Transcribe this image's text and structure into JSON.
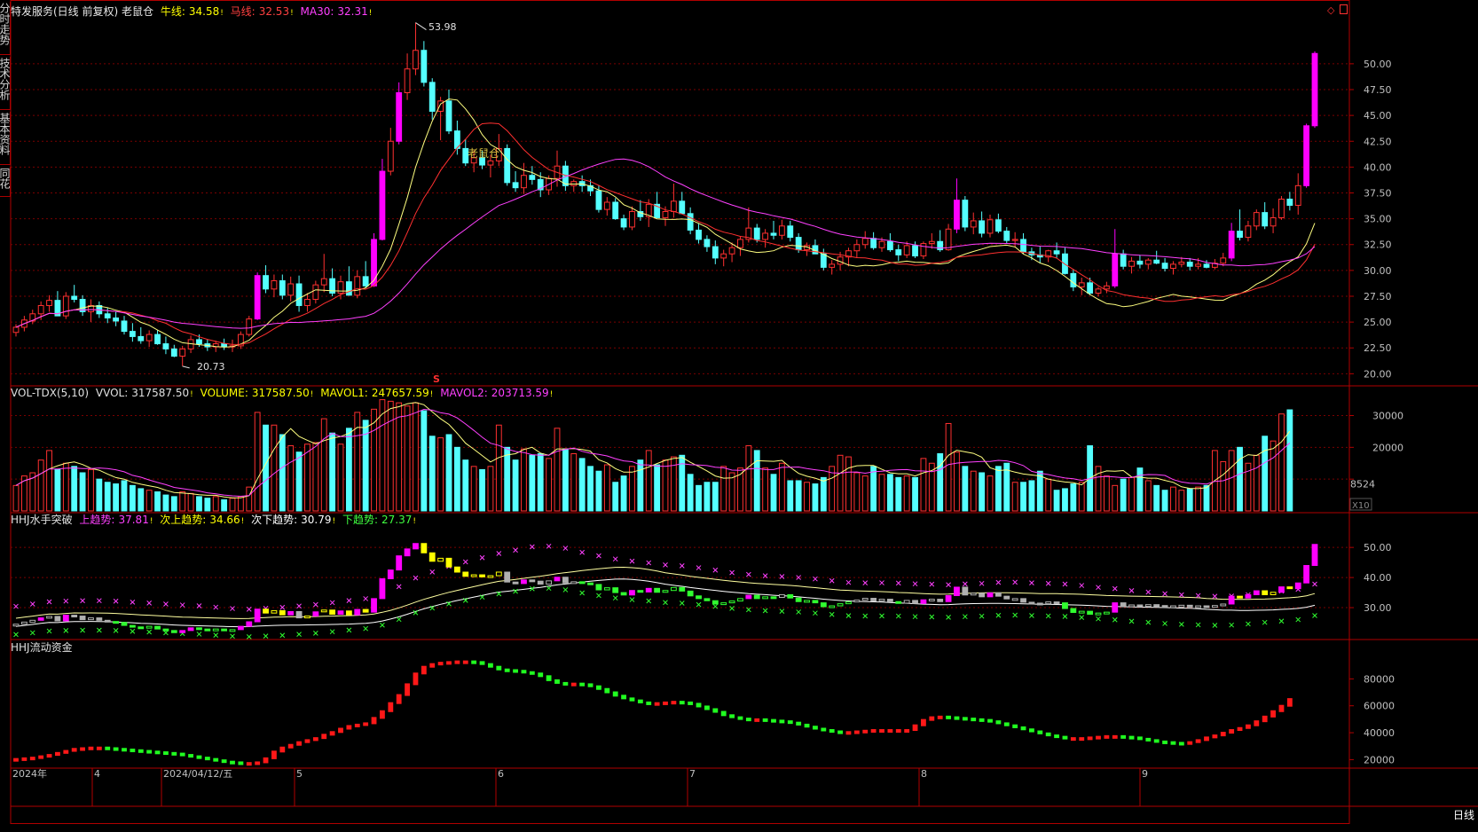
{
  "side_tabs": [
    "分时走势",
    "技术分析",
    "基本资料",
    "同花"
  ],
  "main_header": {
    "title": "特发服务(日线 前复权) 老鼠仓",
    "items": [
      {
        "label": "牛线:",
        "value": "34.58",
        "color": "#ffff00"
      },
      {
        "label": "马线:",
        "value": "32.53",
        "color": "#ff4040"
      },
      {
        "label": "MA30:",
        "value": "32.31",
        "color": "#ff40ff"
      }
    ]
  },
  "high_label": "53.98",
  "low_label": "20.73",
  "watermark_text": "老鼠仓",
  "s_marker": "S",
  "price_axis": [
    "50.00",
    "47.50",
    "45.00",
    "42.50",
    "40.00",
    "37.50",
    "35.00",
    "32.50",
    "30.00",
    "27.50",
    "25.00",
    "22.50",
    "20.00"
  ],
  "vol_header": {
    "title": "VOL-TDX(5,10)",
    "items": [
      {
        "label": "VVOL:",
        "value": "317587.50",
        "color": "#e0e0e0"
      },
      {
        "label": "VOLUME:",
        "value": "317587.50",
        "color": "#ffff00"
      },
      {
        "label": "MAVOL1:",
        "value": "247657.59",
        "color": "#ffff00"
      },
      {
        "label": "MAVOL2:",
        "value": "203713.59",
        "color": "#ff40ff"
      }
    ]
  },
  "vol_axis": [
    "30000",
    "20000",
    "8524"
  ],
  "vol_unit": "X10",
  "hhj_header": {
    "title": "HHJ水手突破",
    "items": [
      {
        "label": "上趋势:",
        "value": "37.81",
        "color": "#ff40ff"
      },
      {
        "label": "次上趋势:",
        "value": "34.66",
        "color": "#ffff00"
      },
      {
        "label": "次下趋势:",
        "value": "30.79",
        "color": "#ffffff"
      },
      {
        "label": "下趋势:",
        "value": "27.37",
        "color": "#40ff40"
      }
    ]
  },
  "hhj_axis": [
    "50.00",
    "40.00",
    "30.00"
  ],
  "flow_header": {
    "title": "HHJ流动资金"
  },
  "flow_axis": [
    "80000",
    "60000",
    "40000",
    "20000"
  ],
  "date_labels": [
    "2024年",
    "4",
    "2024/04/12/五",
    "5",
    "6",
    "7",
    "8",
    "9"
  ],
  "period_label": "日线",
  "colors": {
    "up": "#ff3030",
    "down": "#54ffff",
    "surge": "#ff00ff",
    "ma_fast": "#ffff80",
    "ma_mid": "#ff3030",
    "ma30": "#ff40ff",
    "grid": "#7a0000",
    "border": "#b00000",
    "axis_text": "#c0c0c0"
  },
  "chart_data": {
    "type": "candlestick",
    "price_ylim": [
      19,
      56
    ],
    "high": 53.98,
    "low": 20.73,
    "ohlc": [
      [
        24.0,
        24.8,
        23.6,
        24.5
      ],
      [
        24.5,
        25.6,
        24.1,
        25.2
      ],
      [
        25.1,
        26.2,
        24.8,
        25.8
      ],
      [
        25.8,
        27.0,
        25.2,
        26.6
      ],
      [
        26.6,
        27.6,
        26.0,
        27.1
      ],
      [
        27.1,
        28.0,
        26.4,
        25.6
      ],
      [
        25.6,
        27.9,
        25.3,
        27.5
      ],
      [
        27.5,
        28.6,
        26.9,
        27.2
      ],
      [
        27.2,
        27.6,
        25.6,
        26.0
      ],
      [
        26.0,
        27.2,
        25.0,
        26.6
      ],
      [
        26.6,
        27.0,
        25.4,
        25.8
      ],
      [
        25.8,
        26.4,
        24.9,
        25.4
      ],
      [
        25.4,
        26.0,
        24.6,
        25.1
      ],
      [
        25.1,
        25.6,
        23.8,
        24.1
      ],
      [
        24.1,
        24.9,
        23.1,
        23.6
      ],
      [
        23.6,
        24.5,
        22.9,
        23.2
      ],
      [
        23.2,
        24.2,
        22.6,
        23.8
      ],
      [
        23.8,
        24.2,
        22.8,
        22.9
      ],
      [
        22.9,
        23.6,
        21.9,
        22.4
      ],
      [
        22.4,
        22.8,
        21.6,
        21.7
      ],
      [
        21.7,
        22.7,
        20.73,
        22.4
      ],
      [
        22.4,
        23.7,
        22.0,
        23.3
      ],
      [
        23.3,
        23.8,
        22.6,
        22.9
      ],
      [
        22.9,
        23.3,
        22.2,
        22.6
      ],
      [
        22.6,
        23.2,
        22.1,
        22.9
      ],
      [
        22.9,
        23.4,
        22.3,
        22.6
      ],
      [
        22.6,
        23.3,
        22.1,
        22.7
      ],
      [
        22.7,
        24.1,
        22.4,
        23.8
      ],
      [
        23.8,
        25.6,
        23.6,
        25.3
      ],
      [
        25.3,
        29.8,
        25.2,
        29.5
      ],
      [
        29.5,
        30.5,
        27.8,
        28.2
      ],
      [
        28.2,
        29.6,
        27.4,
        29.0
      ],
      [
        29.0,
        29.6,
        27.2,
        27.6
      ],
      [
        27.6,
        29.4,
        27.0,
        28.7
      ],
      [
        28.7,
        29.5,
        26.0,
        26.6
      ],
      [
        26.6,
        27.8,
        26.0,
        27.2
      ],
      [
        27.2,
        29.0,
        26.8,
        28.6
      ],
      [
        28.6,
        31.6,
        27.9,
        29.2
      ],
      [
        29.2,
        30.2,
        27.5,
        27.8
      ],
      [
        27.8,
        29.5,
        27.2,
        28.9
      ],
      [
        28.9,
        30.4,
        27.6,
        27.6
      ],
      [
        27.6,
        30.0,
        27.3,
        29.4
      ],
      [
        29.4,
        30.9,
        28.3,
        28.5
      ],
      [
        28.5,
        33.6,
        28.4,
        33.0
      ],
      [
        33.0,
        40.8,
        32.9,
        39.6
      ],
      [
        39.6,
        43.8,
        39.2,
        42.5
      ],
      [
        42.5,
        48.2,
        42.2,
        47.2
      ],
      [
        47.2,
        51.0,
        46.5,
        49.5
      ],
      [
        49.5,
        53.98,
        48.9,
        51.3
      ],
      [
        51.3,
        52.2,
        47.8,
        48.2
      ],
      [
        48.2,
        48.6,
        44.6,
        45.4
      ],
      [
        45.4,
        46.8,
        42.6,
        46.4
      ],
      [
        46.4,
        47.5,
        43.2,
        43.5
      ],
      [
        43.5,
        44.5,
        41.2,
        41.8
      ],
      [
        41.8,
        42.7,
        40.1,
        40.4
      ],
      [
        40.4,
        41.6,
        39.5,
        40.9
      ],
      [
        40.9,
        41.6,
        39.8,
        40.2
      ],
      [
        40.2,
        41.2,
        39.0,
        40.6
      ],
      [
        40.6,
        43.2,
        40.1,
        41.8
      ],
      [
        41.8,
        42.2,
        38.2,
        38.5
      ],
      [
        38.5,
        39.6,
        37.6,
        38.0
      ],
      [
        38.0,
        40.4,
        37.4,
        39.2
      ],
      [
        39.2,
        40.1,
        38.3,
        38.8
      ],
      [
        38.8,
        39.5,
        37.1,
        37.8
      ],
      [
        37.8,
        39.2,
        37.3,
        38.9
      ],
      [
        38.9,
        41.6,
        38.1,
        40.1
      ],
      [
        40.1,
        40.6,
        37.7,
        38.2
      ],
      [
        38.2,
        38.8,
        37.6,
        38.6
      ],
      [
        38.6,
        39.2,
        37.6,
        38.2
      ],
      [
        38.2,
        38.8,
        37.2,
        37.7
      ],
      [
        37.7,
        38.2,
        35.6,
        35.9
      ],
      [
        35.9,
        37.1,
        35.3,
        36.6
      ],
      [
        36.6,
        37.0,
        34.9,
        35.0
      ],
      [
        35.0,
        35.4,
        33.9,
        34.2
      ],
      [
        34.2,
        36.2,
        33.9,
        35.7
      ],
      [
        35.7,
        36.8,
        34.8,
        35.2
      ],
      [
        35.2,
        36.9,
        34.2,
        36.4
      ],
      [
        36.4,
        37.6,
        35.6,
        35.1
      ],
      [
        35.1,
        36.2,
        34.3,
        35.7
      ],
      [
        35.7,
        38.4,
        35.1,
        36.7
      ],
      [
        36.7,
        37.6,
        35.6,
        35.5
      ],
      [
        35.5,
        36.1,
        33.5,
        33.9
      ],
      [
        33.9,
        34.5,
        32.6,
        33.0
      ],
      [
        33.0,
        33.4,
        31.8,
        32.3
      ],
      [
        32.3,
        32.9,
        30.6,
        31.2
      ],
      [
        31.2,
        32.0,
        30.4,
        31.6
      ],
      [
        31.6,
        32.7,
        30.8,
        32.2
      ],
      [
        32.2,
        33.3,
        31.4,
        33.0
      ],
      [
        33.0,
        36.1,
        32.7,
        34.1
      ],
      [
        34.1,
        34.5,
        32.7,
        33.0
      ],
      [
        33.0,
        34.0,
        32.2,
        33.6
      ],
      [
        33.6,
        34.8,
        33.0,
        33.4
      ],
      [
        33.4,
        34.9,
        33.0,
        34.3
      ],
      [
        34.3,
        34.8,
        32.8,
        33.2
      ],
      [
        33.2,
        33.6,
        31.7,
        32.0
      ],
      [
        32.0,
        32.7,
        31.4,
        32.4
      ],
      [
        32.4,
        33.0,
        31.6,
        31.6
      ],
      [
        31.6,
        32.1,
        30.0,
        30.3
      ],
      [
        30.3,
        31.0,
        29.6,
        30.6
      ],
      [
        30.6,
        31.8,
        30.0,
        31.3
      ],
      [
        31.3,
        32.2,
        30.4,
        31.9
      ],
      [
        31.9,
        33.0,
        31.2,
        32.5
      ],
      [
        32.5,
        33.8,
        32.1,
        33.1
      ],
      [
        33.1,
        33.7,
        32.0,
        32.2
      ],
      [
        32.2,
        33.2,
        31.8,
        32.8
      ],
      [
        32.8,
        33.6,
        31.8,
        32.0
      ],
      [
        32.0,
        32.5,
        30.9,
        31.5
      ],
      [
        31.5,
        32.8,
        31.2,
        32.4
      ],
      [
        32.4,
        32.8,
        31.2,
        31.4
      ],
      [
        31.4,
        32.8,
        31.1,
        32.6
      ],
      [
        32.6,
        33.6,
        32.1,
        32.8
      ],
      [
        32.8,
        33.9,
        31.8,
        32.0
      ],
      [
        32.0,
        34.5,
        31.9,
        34.0
      ],
      [
        34.0,
        38.9,
        33.6,
        36.8
      ],
      [
        36.8,
        37.2,
        33.8,
        34.2
      ],
      [
        34.2,
        35.6,
        33.5,
        34.8
      ],
      [
        34.8,
        35.7,
        33.2,
        33.6
      ],
      [
        33.6,
        35.4,
        33.2,
        34.9
      ],
      [
        34.9,
        35.5,
        33.6,
        33.8
      ],
      [
        33.8,
        34.2,
        32.6,
        32.9
      ],
      [
        32.9,
        33.7,
        32.3,
        33.0
      ],
      [
        33.0,
        33.6,
        31.6,
        31.8
      ],
      [
        31.8,
        32.2,
        31.0,
        31.5
      ],
      [
        31.5,
        32.3,
        30.7,
        31.3
      ],
      [
        31.3,
        32.0,
        30.8,
        31.9
      ],
      [
        31.9,
        32.7,
        31.2,
        31.6
      ],
      [
        31.6,
        32.2,
        29.6,
        29.7
      ],
      [
        29.7,
        30.1,
        28.0,
        28.4
      ],
      [
        28.4,
        29.3,
        27.6,
        28.8
      ],
      [
        28.8,
        29.3,
        27.6,
        27.8
      ],
      [
        27.8,
        28.4,
        27.5,
        28.2
      ],
      [
        28.2,
        28.9,
        27.8,
        28.5
      ],
      [
        28.5,
        34.0,
        28.3,
        31.6
      ],
      [
        31.6,
        32.0,
        30.1,
        30.4
      ],
      [
        30.4,
        31.3,
        29.7,
        30.9
      ],
      [
        30.9,
        31.5,
        30.2,
        30.6
      ],
      [
        30.6,
        31.2,
        30.1,
        31.0
      ],
      [
        31.0,
        31.9,
        30.6,
        30.7
      ],
      [
        30.7,
        31.2,
        29.9,
        30.2
      ],
      [
        30.2,
        30.9,
        29.6,
        30.6
      ],
      [
        30.6,
        31.3,
        30.3,
        30.8
      ],
      [
        30.8,
        31.2,
        30.0,
        30.4
      ],
      [
        30.4,
        31.2,
        30.1,
        30.6
      ],
      [
        30.6,
        31.0,
        30.2,
        30.3
      ],
      [
        30.3,
        31.1,
        30.1,
        30.7
      ],
      [
        30.7,
        31.7,
        30.4,
        31.2
      ],
      [
        31.2,
        34.6,
        30.9,
        33.8
      ],
      [
        33.8,
        35.9,
        32.9,
        33.2
      ],
      [
        33.2,
        34.8,
        32.8,
        34.3
      ],
      [
        34.3,
        35.9,
        33.9,
        35.6
      ],
      [
        35.6,
        36.6,
        34.0,
        34.3
      ],
      [
        34.3,
        36.0,
        33.6,
        35.1
      ],
      [
        35.1,
        37.2,
        34.9,
        36.9
      ],
      [
        36.9,
        37.6,
        35.8,
        36.3
      ],
      [
        36.3,
        39.4,
        35.4,
        38.2
      ],
      [
        38.2,
        44.2,
        38.0,
        44.0
      ],
      [
        44.0,
        51.2,
        43.8,
        51.0
      ]
    ],
    "ma_fast_end": 34.58,
    "ma_mid_end": 32.53,
    "ma30_end": 32.31,
    "volume_ylim": [
      0,
      36000
    ],
    "volume": [
      8000,
      11000,
      12000,
      16000,
      19000,
      13000,
      15000,
      14000,
      12000,
      13000,
      10000,
      9000,
      8500,
      9500,
      8000,
      7000,
      6500,
      6000,
      5000,
      4500,
      6000,
      5500,
      4500,
      4000,
      4500,
      3500,
      4000,
      4500,
      7500,
      31000,
      27000,
      27000,
      24000,
      20500,
      18500,
      21000,
      21500,
      29000,
      24500,
      21000,
      26000,
      31000,
      28500,
      32000,
      35000,
      34500,
      34000,
      33000,
      34000,
      31500,
      23500,
      23000,
      24000,
      20000,
      16000,
      14000,
      13000,
      14000,
      27000,
      20000,
      16000,
      19500,
      17500,
      18000,
      16500,
      26000,
      19500,
      18000,
      16500,
      14000,
      12500,
      14500,
      9000,
      11000,
      14000,
      16000,
      19000,
      14500,
      16000,
      17000,
      17500,
      11500,
      8000,
      9000,
      9000,
      14000,
      12000,
      13500,
      20500,
      19000,
      13500,
      11500,
      15000,
      9500,
      9500,
      9000,
      8500,
      10500,
      14000,
      17500,
      17000,
      12000,
      11000,
      14000,
      11500,
      11500,
      10500,
      11000,
      10500,
      16500,
      15000,
      18000,
      27500,
      18500,
      14000,
      12500,
      12000,
      11000,
      14000,
      15000,
      9000,
      9000,
      9500,
      12500,
      10000,
      6500,
      7000,
      8500,
      9000,
      20500,
      14000,
      11000,
      8000,
      10000,
      10500,
      13500,
      9500,
      8000,
      6500,
      7500,
      6500,
      7000,
      7500,
      8000,
      19000,
      15500,
      19000,
      20000,
      15000,
      17500,
      23500,
      22000,
      30500,
      31800
    ],
    "hhj_ylim": [
      20,
      58
    ],
    "hhj_up_end": 37.81,
    "hhj_subup_end": 34.66,
    "hhj_subdown_end": 30.79,
    "hhj_down_end": 27.37,
    "flow_ylim": [
      15000,
      100000
    ],
    "flow": [
      20500,
      21000,
      21500,
      22500,
      23500,
      25000,
      26500,
      28000,
      28500,
      29000,
      29000,
      28500,
      28000,
      27500,
      27000,
      26500,
      26000,
      25500,
      25000,
      24500,
      23500,
      22500,
      21500,
      20500,
      19500,
      18500,
      18000,
      17500,
      17500,
      18000,
      21000,
      26000,
      29000,
      31000,
      33000,
      34500,
      36000,
      38500,
      40500,
      43000,
      45000,
      46000,
      47000,
      51000,
      56000,
      62000,
      68000,
      76000,
      84000,
      89000,
      91000,
      92000,
      92500,
      93000,
      93000,
      92500,
      91000,
      89000,
      87000,
      86500,
      86000,
      85000,
      84000,
      82000,
      79000,
      77000,
      76500,
      76500,
      76000,
      74500,
      72500,
      70000,
      67500,
      65500,
      64000,
      62500,
      62000,
      62000,
      62500,
      63000,
      62500,
      61500,
      59500,
      57500,
      55500,
      53000,
      51500,
      50500,
      50000,
      50000,
      49500,
      49000,
      48500,
      47500,
      46000,
      44500,
      43000,
      42000,
      41000,
      40500,
      40500,
      41000,
      41500,
      42000,
      42000,
      42000,
      42000,
      42000,
      45500,
      49500,
      51500,
      52000,
      51500,
      51000,
      50500,
      50000,
      49500,
      48500,
      47000,
      45500,
      44000,
      42500,
      41000,
      39500,
      38000,
      37000,
      36000,
      36000,
      36000,
      36500,
      37000,
      37500,
      37500,
      37000,
      36500,
      35500,
      34500,
      33500,
      33000,
      32500,
      32000,
      33000,
      34500,
      36500,
      38000,
      40000,
      42000,
      43500,
      45500,
      48500,
      52000,
      56000,
      60000,
      65000
    ]
  }
}
